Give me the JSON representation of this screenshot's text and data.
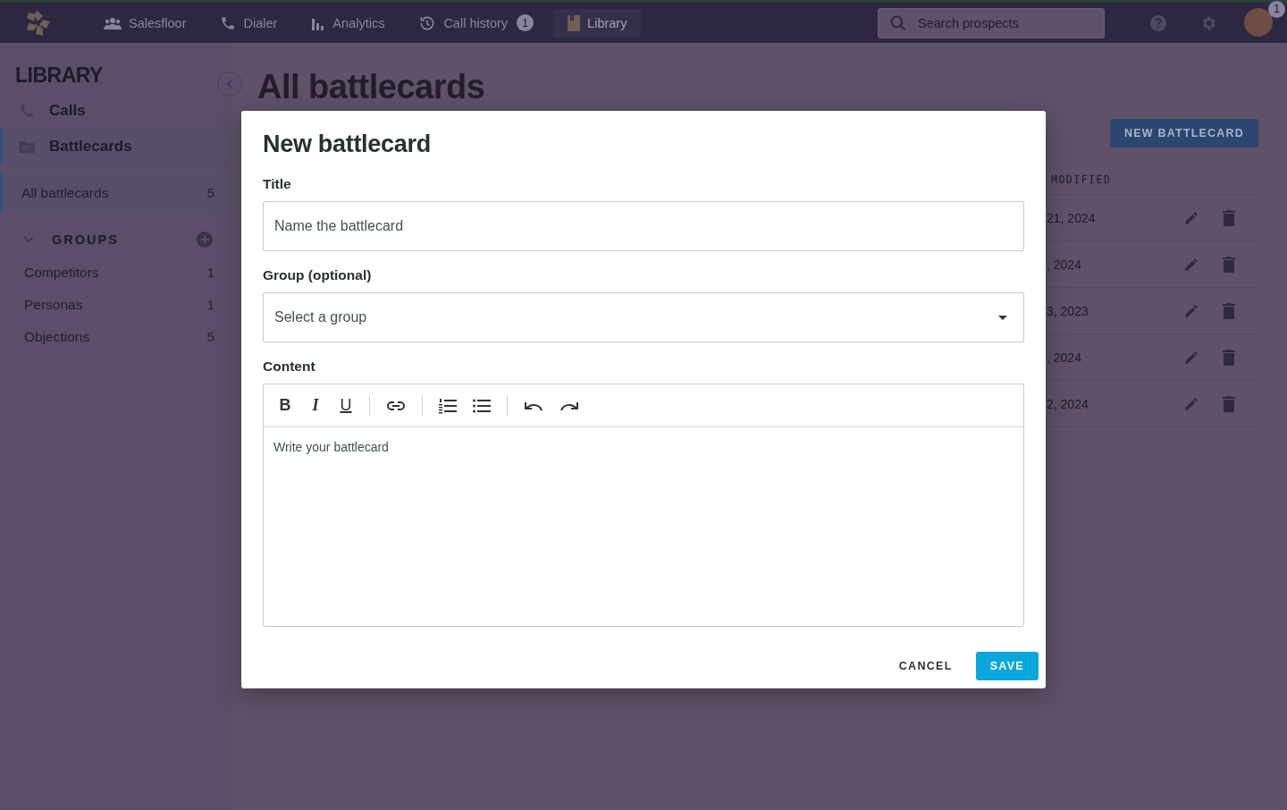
{
  "top_bar": {
    "nav": [
      {
        "kind": "salesfloor",
        "label": "Salesfloor",
        "selected": false
      },
      {
        "kind": "dialer",
        "label": "Dialer",
        "selected": false
      },
      {
        "kind": "analytics",
        "label": "Analytics",
        "selected": false
      },
      {
        "kind": "history",
        "label": "Call history",
        "badge": "1",
        "selected": false
      },
      {
        "kind": "library",
        "label": "Library",
        "selected": true
      }
    ],
    "search": {
      "placeholder": "Search prospects"
    },
    "avatar_badge": "1"
  },
  "sidebar": {
    "title": "LIBRARY",
    "sections": [
      {
        "kind": "calls",
        "label": "Calls",
        "selected": false
      },
      {
        "kind": "battlecards",
        "label": "Battlecards",
        "selected": true
      }
    ],
    "all": {
      "label": "All battlecards",
      "count": "5",
      "selected": true
    },
    "groups": {
      "label": "GROUPS",
      "expanded": true,
      "items": [
        {
          "label": "Competitors",
          "count": "1"
        },
        {
          "label": "Personas",
          "count": "1"
        },
        {
          "label": "Objections",
          "count": "5"
        }
      ]
    }
  },
  "main": {
    "title": "All battlecards",
    "new_button": "NEW BATTLECARD",
    "table": {
      "column_header": "MODIFIED",
      "rows": [
        {
          "modified": "21, 2024"
        },
        {
          "modified": ", 2024"
        },
        {
          "modified": "3, 2023"
        },
        {
          "modified": ", 2024"
        },
        {
          "modified": "2, 2024"
        }
      ]
    }
  },
  "dialog": {
    "title": "New battlecard",
    "fields": [
      {
        "kind": "text",
        "label": "Title",
        "placeholder": "Name the battlecard"
      },
      {
        "kind": "select",
        "label": "Group (optional)",
        "placeholder": "Select a group"
      },
      {
        "kind": "editor",
        "label": "Content",
        "placeholder": "Write your battlecard"
      }
    ],
    "toolbar": [
      [
        {
          "kind": "bold",
          "glyph": "B"
        },
        {
          "kind": "italic",
          "glyph": "I"
        },
        {
          "kind": "underline",
          "glyph": "U"
        }
      ],
      [
        {
          "kind": "link"
        }
      ],
      [
        {
          "kind": "numbered-list"
        },
        {
          "kind": "bulleted-list"
        }
      ],
      [
        {
          "kind": "undo"
        },
        {
          "kind": "redo"
        }
      ]
    ],
    "buttons": [
      {
        "kind": "text",
        "label": "CANCEL"
      },
      {
        "kind": "primary",
        "label": "SAVE"
      }
    ]
  }
}
